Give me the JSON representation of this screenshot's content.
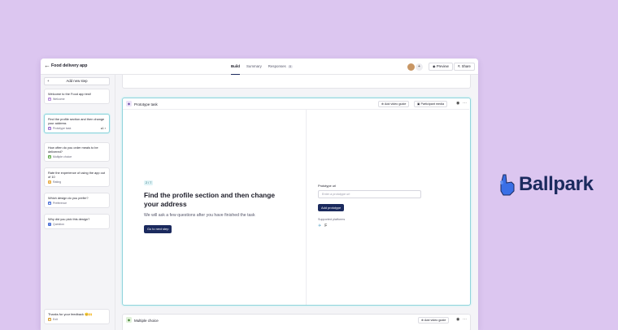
{
  "header": {
    "back_icon": "arrow-left-icon",
    "app_title": "Food delivery app",
    "tabs": [
      {
        "label": "Build",
        "active": true
      },
      {
        "label": "Summary",
        "active": false
      },
      {
        "label": "Responses",
        "active": false,
        "count": "0"
      }
    ],
    "avatar_more": "+",
    "preview_label": "Preview",
    "share_label": "Share"
  },
  "sidebar": {
    "add_step_label": "Add new step",
    "steps": [
      {
        "title": "Welcome to the Food app test!",
        "type": "Welcome",
        "icon": "welcome-icon",
        "color": "#b48ad8"
      },
      {
        "title": "Find the profile section and then change your address",
        "type": "Prototype task",
        "icon": "prototype-icon",
        "color": "#9a6fd0",
        "selected": true,
        "comments": "1",
        "meta_icon": "comment-icon"
      },
      {
        "title": "How often do you order meals to be delivered?",
        "type": "Multiple choice",
        "icon": "multiple-choice-icon",
        "color": "#5fa84a"
      },
      {
        "title": "Rate the experience of using the app out of 10",
        "type": "Rating",
        "icon": "rating-icon",
        "color": "#e6a83a"
      },
      {
        "title": "Which design do you prefer?",
        "type": "Preference",
        "icon": "preference-icon",
        "color": "#4a6fd6"
      },
      {
        "title": "Why did you pick this design?",
        "type": "Question",
        "icon": "question-icon",
        "color": "#4a6fd6"
      },
      {
        "title": "Thanks for your feedback 😊🙌",
        "type": "Exit",
        "icon": "exit-icon",
        "color": "#d6a03a"
      }
    ]
  },
  "task": {
    "header_title": "Prototype task",
    "add_video_label": "Add video guide",
    "media_label": "Participant media",
    "step_badge": "2 / 7",
    "question": "Find the profile section and then change your address",
    "subtext": "We will ask a few questions after you have finished the task",
    "next_label": "Go to next step",
    "url_label": "Prototype url",
    "url_placeholder": "Enter a prototype url",
    "add_prototype_label": "Add prototype",
    "platforms_label": "Supported platforms"
  },
  "next_card": {
    "title": "Multiple choice",
    "add_video_label": "Add video guide"
  },
  "brand": {
    "name": "Ballpark",
    "color": "#1b2a5e",
    "accent": "#3a6fe6"
  }
}
